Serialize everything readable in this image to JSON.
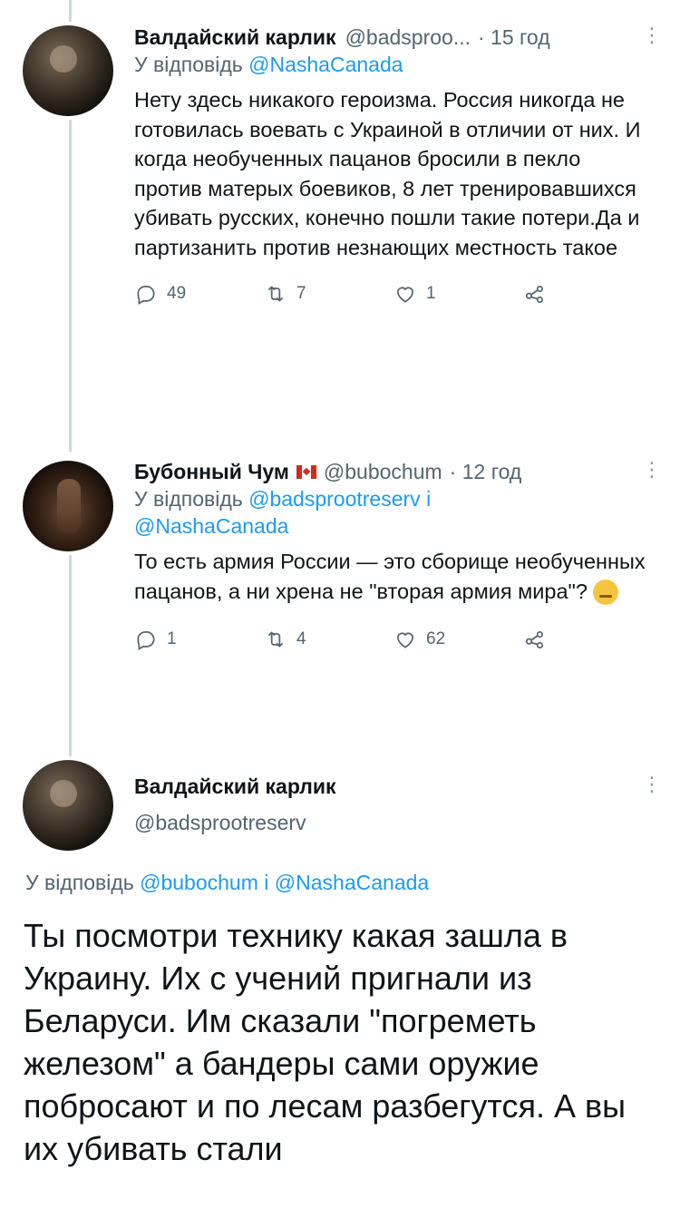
{
  "tweets": [
    {
      "display_name": "Валдайский карлик",
      "handle": "@badsproo...",
      "time": "· 15 год",
      "reply_prefix": "У відповідь",
      "reply_to": "@NashaCanada",
      "text": "Нету здесь никакого героизма. Россия никогда не готовилась воевать с Украиной в отличии от них. И когда необученных пацанов бросили в пекло против матерых боевиков, 8 лет тренировавшихся убивать русских, конечно пошли такие потери.Да и партизанить против незнающих местность такое",
      "replies": "49",
      "retweets": "7",
      "likes": "1"
    },
    {
      "display_name": "Бубонный Чум",
      "handle": "@bubochum",
      "time": "· 12 год",
      "reply_prefix": "У відповідь",
      "reply_to_1": "@badsprootreserv",
      "reply_and": "і",
      "reply_to_2": "@NashaCanada",
      "text": "То есть армия России — это сборище необученных пацанов, а ни хрена не \"вторая армия мира\"?",
      "replies": "1",
      "retweets": "4",
      "likes": "62"
    }
  ],
  "focused": {
    "display_name": "Валдайский карлик",
    "handle": "@badsprootreserv",
    "reply_prefix": "У відповідь",
    "reply_to_1": "@bubochum",
    "reply_and": "і",
    "reply_to_2": "@NashaCanada",
    "text": "Ты посмотри технику какая зашла в Украину. Их с учений пригнали из Беларуси. Им сказали \"погреметь железом\" а бандеры сами оружие побросают и по лесам разбегутся. А вы их убивать стали"
  },
  "colors": {
    "link": "#1d9bf0",
    "muted": "#536471",
    "thread_line": "#cfd9de"
  },
  "icons": [
    "reply-icon",
    "retweet-icon",
    "like-icon",
    "share-icon",
    "more-icon"
  ]
}
